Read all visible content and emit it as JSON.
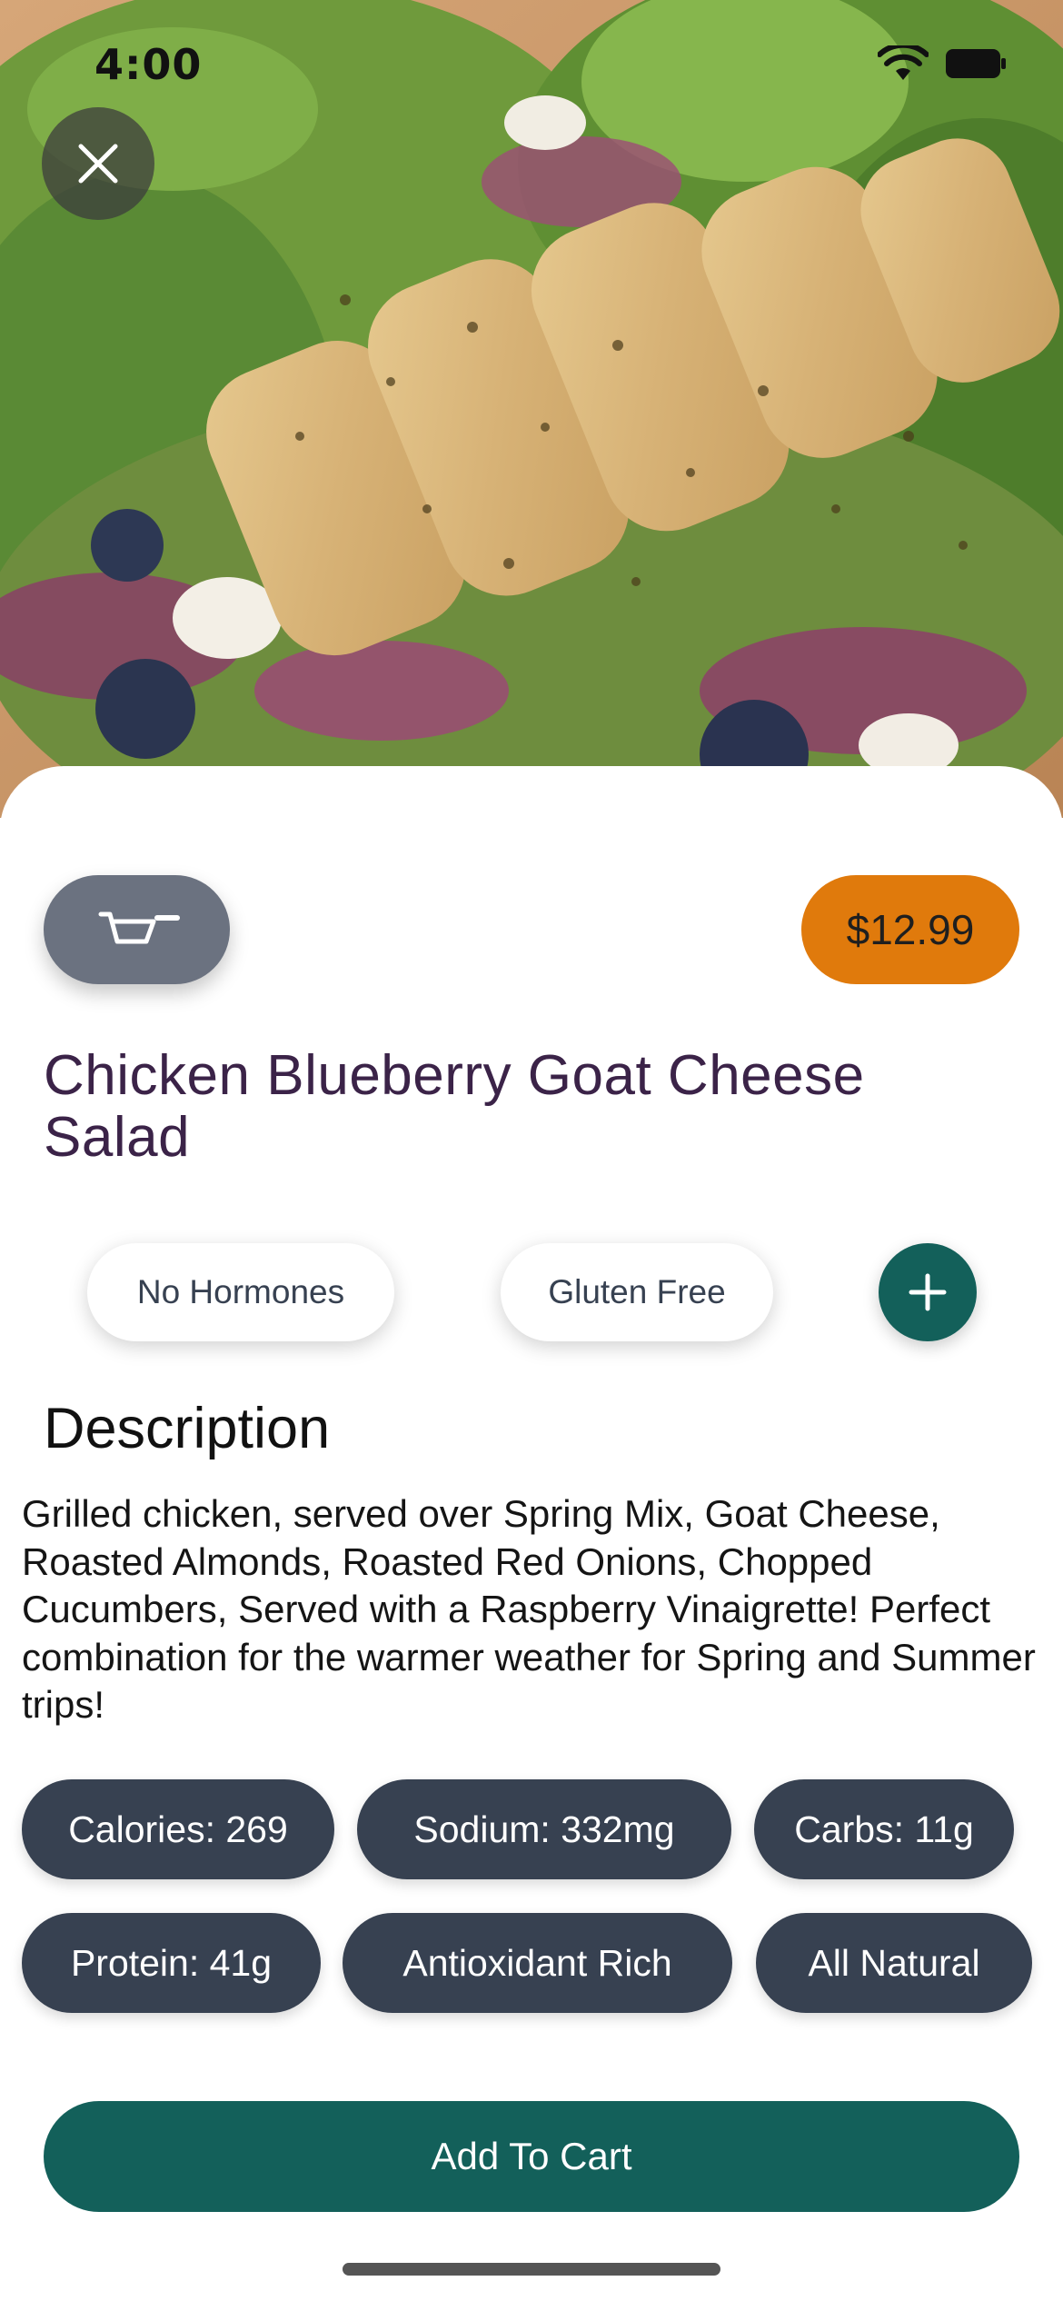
{
  "status_bar": {
    "time": "4:00"
  },
  "header": {
    "close_icon": "close-icon",
    "hero_image": "grilled chicken salad photo"
  },
  "actions": {
    "cart_icon": "cart-icon",
    "price": "$12.99"
  },
  "product": {
    "title": "Chicken Blueberry Goat Cheese Salad"
  },
  "tags": [
    "No Hormones",
    "Gluten Free"
  ],
  "add_tag_icon": "plus-icon",
  "description": {
    "heading": "Description",
    "body": "Grilled chicken, served over Spring Mix, Goat Cheese, Roasted Almonds, Roasted Red Onions, Chopped Cucumbers, Served with a Raspberry Vinaigrette! Perfect combination for the warmer weather for Spring and Summer trips!"
  },
  "nutrition_chips": [
    "Calories: 269",
    "Sodium: 332mg",
    "Carbs: 11g",
    "Protein: 41g",
    "Antioxidant Rich",
    "All Natural"
  ],
  "cta": {
    "add_to_cart_label": "Add To Cart"
  },
  "colors": {
    "accent_green": "#13605a",
    "price_orange": "#e07a0c",
    "chip_slate": "#374151",
    "cart_gray": "#6b7280",
    "title_purple": "#3b2348"
  }
}
